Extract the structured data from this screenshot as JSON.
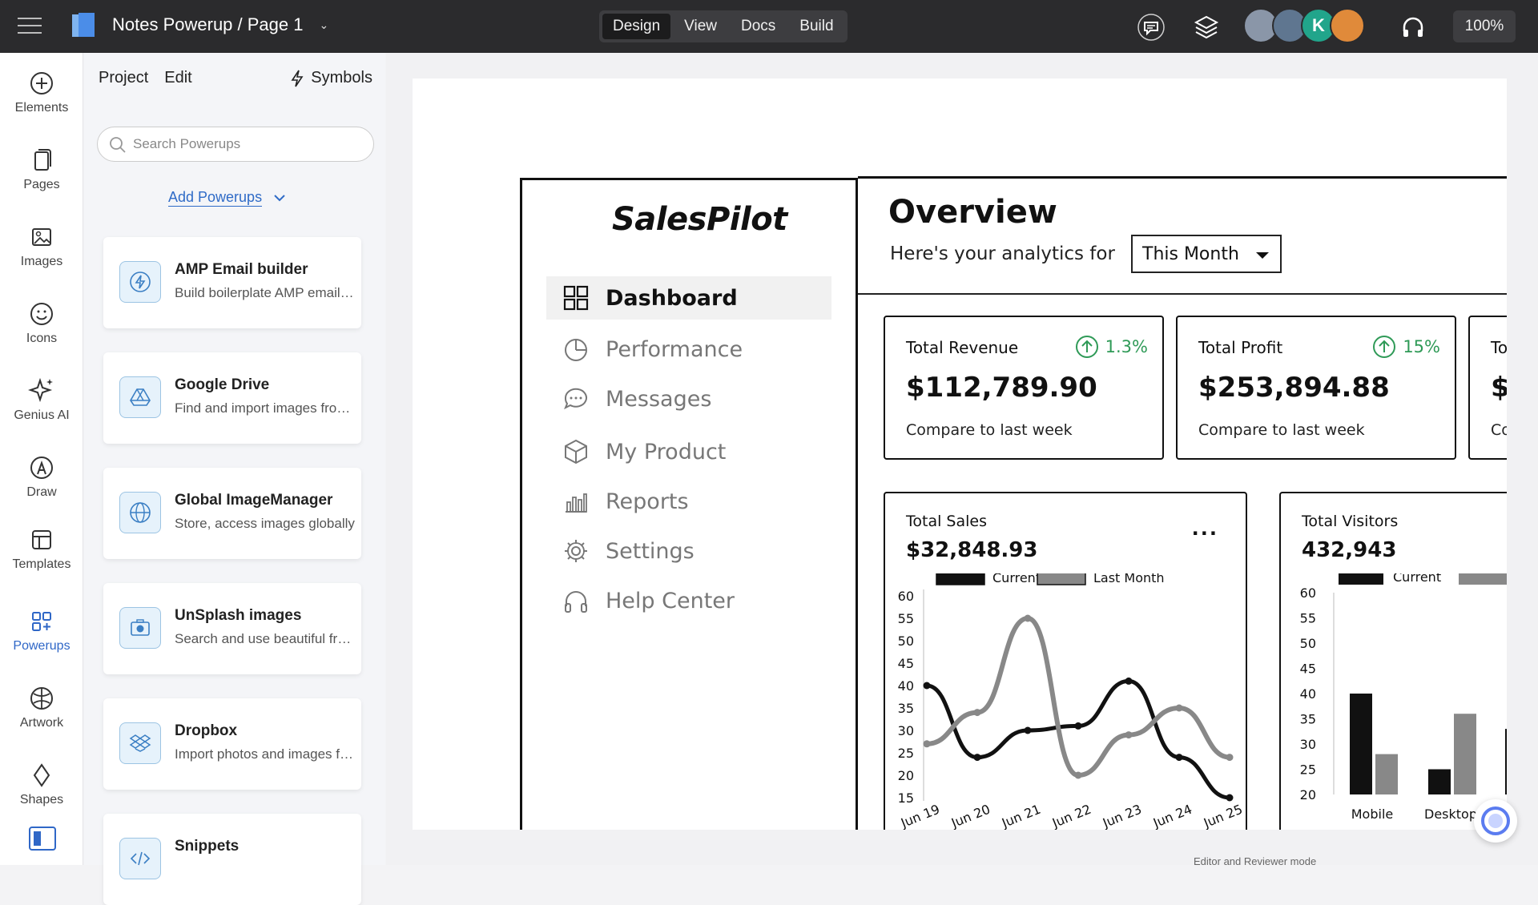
{
  "app": {
    "title": "Notes Powerup / Page 1",
    "modes": [
      "Design",
      "View",
      "Docs",
      "Build"
    ],
    "active_mode": "Design",
    "avatar_initial": "K",
    "zoom": "100%"
  },
  "rail": {
    "items": [
      "Elements",
      "Pages",
      "Images",
      "Icons",
      "Genius AI",
      "Draw",
      "Templates",
      "Powerups",
      "Artwork",
      "Shapes"
    ],
    "active": "Powerups"
  },
  "panel": {
    "tabs": [
      "Project",
      "Edit"
    ],
    "symbols_label": "Symbols",
    "search_placeholder": "Search Powerups",
    "add_powerups": "Add Powerups",
    "cards": [
      {
        "title": "AMP Email builder",
        "desc": "Build boilerplate AMP email templates",
        "icon": "lightning-icon"
      },
      {
        "title": "Google Drive",
        "desc": "Find and import images from Google Drive",
        "icon": "google-drive-icon"
      },
      {
        "title": "Global ImageManager",
        "desc": "Store, access images globally",
        "icon": "globe-image-icon"
      },
      {
        "title": "UnSplash images",
        "desc": "Search and use beautiful free photos",
        "icon": "camera-icon"
      },
      {
        "title": "Dropbox",
        "desc": "Import photos and images from Dropbox",
        "icon": "dropbox-icon"
      },
      {
        "title": "Snippets",
        "desc": "",
        "icon": "code-icon"
      }
    ]
  },
  "wireframe": {
    "logo": "SalesPilot",
    "nav": [
      "Dashboard",
      "Performance",
      "Messages",
      "My Product",
      "Reports",
      "Settings",
      "Help Center"
    ],
    "active_nav": "Dashboard",
    "heading": "Overview",
    "subheading": "Here's your analytics for",
    "period": "This Month",
    "stats": [
      {
        "label": "Total Revenue",
        "change": "1.3%",
        "value": "$112,789.90",
        "compare": "Compare to last week"
      },
      {
        "label": "Total Profit",
        "change": "15%",
        "value": "$253,894.88",
        "compare": "Compare to last week"
      },
      {
        "label": "To",
        "change": "",
        "value": "$",
        "compare": "Co"
      }
    ],
    "sales": {
      "label": "Total Sales",
      "value": "$32,848.93",
      "more": "..."
    },
    "visitors": {
      "label": "Total Visitors",
      "value": "432,943"
    },
    "footnote": "Editor and Reviewer mode"
  },
  "chart_data": [
    {
      "type": "line",
      "title": "",
      "categories": [
        "Jun 19",
        "Jun 20",
        "Jun 21",
        "Jun 22",
        "Jun 23",
        "Jun 24",
        "Jun 25"
      ],
      "ylim": [
        15,
        60
      ],
      "yticks": [
        60,
        55,
        50,
        45,
        40,
        35,
        30,
        25,
        20,
        15
      ],
      "legend": "top",
      "series": [
        {
          "name": "Current",
          "values": [
            40,
            24,
            30,
            31,
            41,
            24,
            15
          ],
          "color": "#111111"
        },
        {
          "name": "Last Month",
          "values": [
            27,
            34,
            55,
            20,
            29,
            35,
            24
          ],
          "color": "#888888"
        }
      ]
    },
    {
      "type": "bar",
      "title": "",
      "categories": [
        "Mobile",
        "Desktop"
      ],
      "ylim": [
        20,
        60
      ],
      "yticks": [
        60,
        55,
        50,
        45,
        40,
        35,
        30,
        25,
        20
      ],
      "legend": "top",
      "series": [
        {
          "name": "Current",
          "values": [
            40,
            25
          ],
          "color": "#111111"
        },
        {
          "name": "Last Month",
          "values": [
            28,
            36
          ],
          "color": "#888888"
        }
      ]
    }
  ]
}
